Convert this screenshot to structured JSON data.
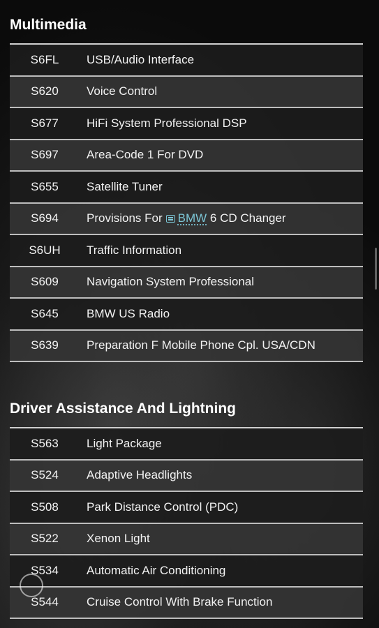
{
  "sections": [
    {
      "title": "Multimedia",
      "rows": [
        {
          "code": "S6FL",
          "desc": "USB/Audio Interface"
        },
        {
          "code": "S620",
          "desc": "Voice Control"
        },
        {
          "code": "S677",
          "desc": "HiFi System Professional DSP"
        },
        {
          "code": "S697",
          "desc": "Area-Code 1 For DVD"
        },
        {
          "code": "S655",
          "desc": "Satellite Tuner"
        },
        {
          "code": "S694",
          "desc_pre": "Provisions For",
          "desc_link": "BMW",
          "desc_post": "6 CD Changer"
        },
        {
          "code": "S6UH",
          "desc": "Traffic Information"
        },
        {
          "code": "S609",
          "desc": "Navigation System Professional"
        },
        {
          "code": "S645",
          "desc": "BMW US Radio"
        },
        {
          "code": "S639",
          "desc": "Preparation F Mobile Phone Cpl. USA/CDN"
        }
      ]
    },
    {
      "title": "Driver Assistance And Lightning",
      "rows": [
        {
          "code": "S563",
          "desc": "Light Package"
        },
        {
          "code": "S524",
          "desc": "Adaptive Headlights"
        },
        {
          "code": "S508",
          "desc": "Park Distance Control (PDC)"
        },
        {
          "code": "S522",
          "desc": "Xenon Light"
        },
        {
          "code": "S534",
          "desc": "Automatic Air Conditioning"
        },
        {
          "code": "S544",
          "desc": "Cruise Control With Brake Function"
        }
      ]
    }
  ],
  "colors": {
    "link": "#7cc6d6",
    "row_odd": "#1c1c1c",
    "row_even": "#343434",
    "border": "#bdbdbd"
  },
  "icons": {
    "link_icon": "document-link-icon"
  }
}
